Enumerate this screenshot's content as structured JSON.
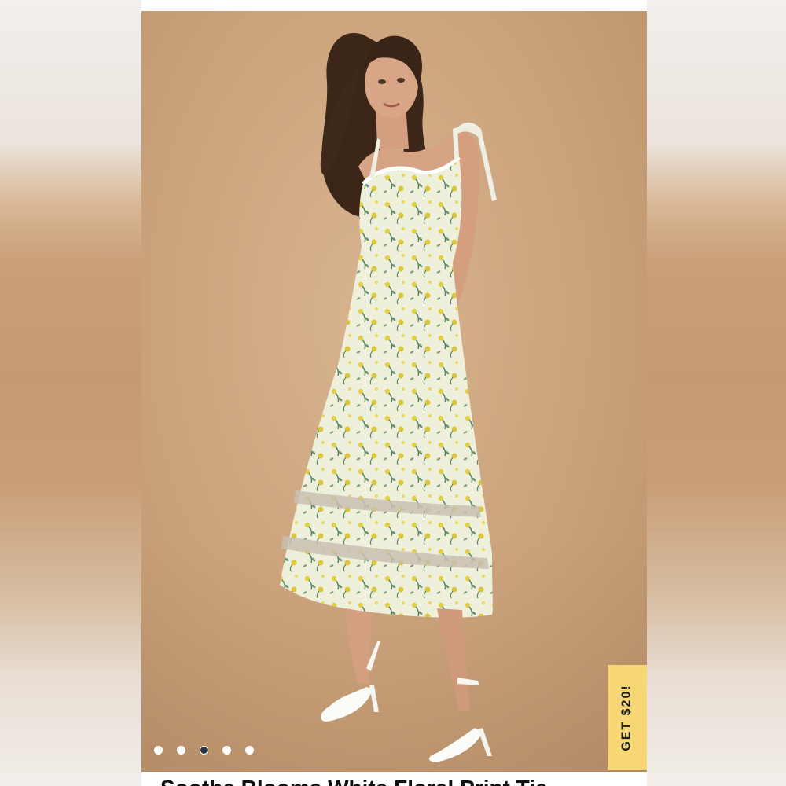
{
  "product": {
    "title": "Soothe Blooms White Floral Print Tie-"
  },
  "promo": {
    "label": "GET $20!",
    "color": "#f6d773"
  },
  "favorite": {
    "icon": "heart-v-icon"
  },
  "carousel": {
    "total": 5,
    "active_index": 3
  },
  "colors": {
    "photo_background": "#caa27b",
    "dot_active": "#2c3440",
    "dot_inactive": "#ffffff"
  }
}
